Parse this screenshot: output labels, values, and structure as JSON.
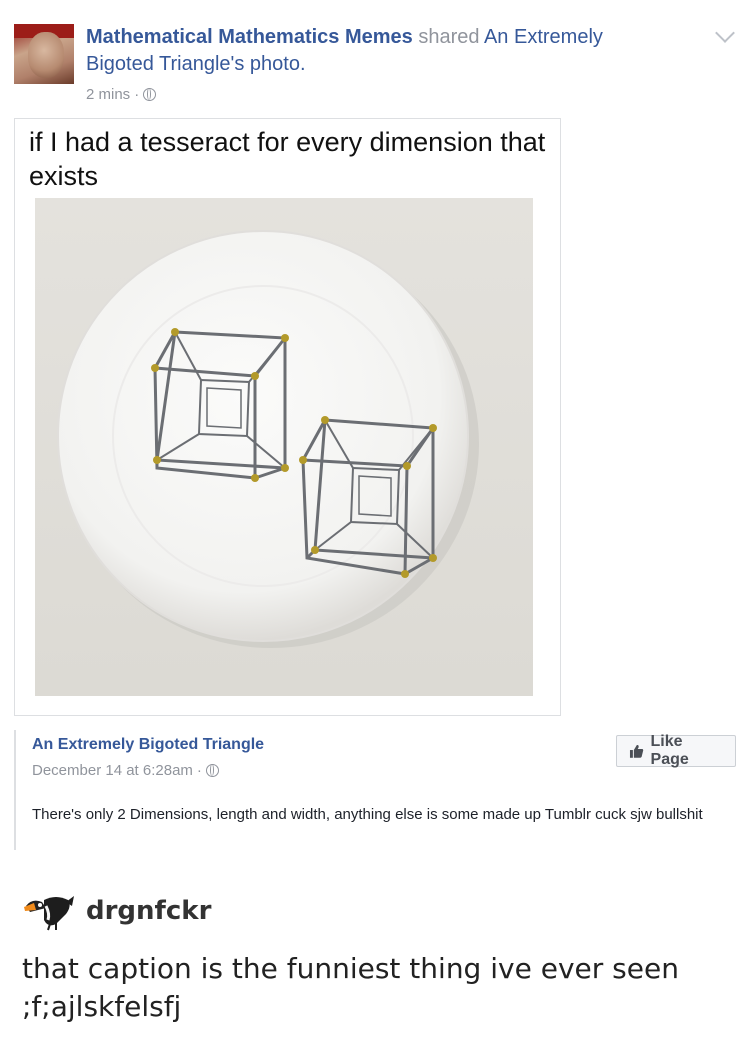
{
  "post": {
    "page_name": "Mathematical Mathematics Memes",
    "shared_word": "shared",
    "shared_from": "An Extremely Bigoted Triangle's photo.",
    "time": "2 mins",
    "privacy_icon": "globe-icon",
    "menu_icon": "chevron-down-icon"
  },
  "meme": {
    "caption": "if I had a tesseract for every dimension that exists",
    "image_icon": "plate-with-tesseracts"
  },
  "shared": {
    "author": "An Extremely Bigoted Triangle",
    "date": "December 14 at 6:28am",
    "like_page_label": "Like Page",
    "text": "There's only 2 Dimensions, length and width, anything else is some made up Tumblr cuck sjw bullshit"
  },
  "tumblr": {
    "username": "drgnfckr",
    "avatar_icon": "toucan-icon",
    "caption": "that caption is the funniest thing ive ever seen ;f;ajlskfelsfj"
  },
  "colors": {
    "link_blue": "#365899",
    "meta_gray": "#90949c",
    "plate_white": "#f7f7f5",
    "tesseract_gray": "#6b6e73",
    "vertex_gold": "#b39a2a"
  }
}
